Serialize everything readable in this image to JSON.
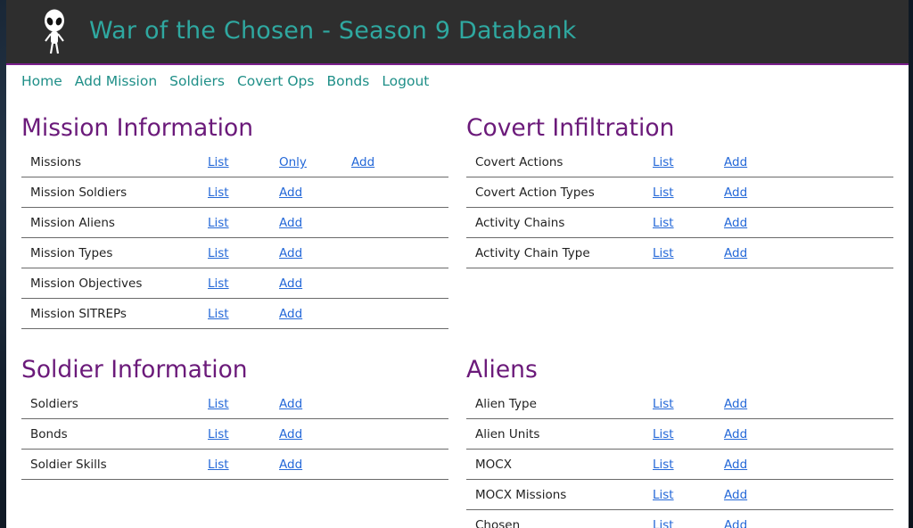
{
  "header": {
    "title": "War of the Chosen - Season 9 Databank"
  },
  "nav": [
    {
      "label": "Home"
    },
    {
      "label": "Add Mission"
    },
    {
      "label": "Soldiers"
    },
    {
      "label": "Covert Ops"
    },
    {
      "label": "Bonds"
    },
    {
      "label": "Logout"
    }
  ],
  "sections": {
    "mission": {
      "title": "Mission Information",
      "rows": [
        {
          "label": "Missions",
          "links": [
            "List",
            "Only",
            "Add"
          ]
        },
        {
          "label": "Mission Soldiers",
          "links": [
            "List",
            "Add"
          ]
        },
        {
          "label": "Mission Aliens",
          "links": [
            "List",
            "Add"
          ]
        },
        {
          "label": "Mission Types",
          "links": [
            "List",
            "Add"
          ]
        },
        {
          "label": "Mission Objectives",
          "links": [
            "List",
            "Add"
          ]
        },
        {
          "label": "Mission SITREPs",
          "links": [
            "List",
            "Add"
          ]
        }
      ]
    },
    "covert": {
      "title": "Covert Infiltration",
      "rows": [
        {
          "label": "Covert Actions",
          "links": [
            "List",
            "Add"
          ]
        },
        {
          "label": "Covert Action Types",
          "links": [
            "List",
            "Add"
          ]
        },
        {
          "label": "Activity Chains",
          "links": [
            "List",
            "Add"
          ]
        },
        {
          "label": "Activity Chain Type",
          "links": [
            "List",
            "Add"
          ]
        }
      ]
    },
    "soldier": {
      "title": "Soldier Information",
      "rows": [
        {
          "label": "Soldiers",
          "links": [
            "List",
            "Add"
          ]
        },
        {
          "label": "Bonds",
          "links": [
            "List",
            "Add"
          ]
        },
        {
          "label": "Soldier Skills",
          "links": [
            "List",
            "Add"
          ]
        }
      ]
    },
    "aliens": {
      "title": "Aliens",
      "rows": [
        {
          "label": "Alien Type",
          "links": [
            "List",
            "Add"
          ]
        },
        {
          "label": "Alien Units",
          "links": [
            "List",
            "Add"
          ]
        },
        {
          "label": "MOCX",
          "links": [
            "List",
            "Add"
          ]
        },
        {
          "label": "MOCX Missions",
          "links": [
            "List",
            "Add"
          ]
        },
        {
          "label": "Chosen",
          "links": [
            "List",
            "Add"
          ]
        }
      ]
    }
  }
}
